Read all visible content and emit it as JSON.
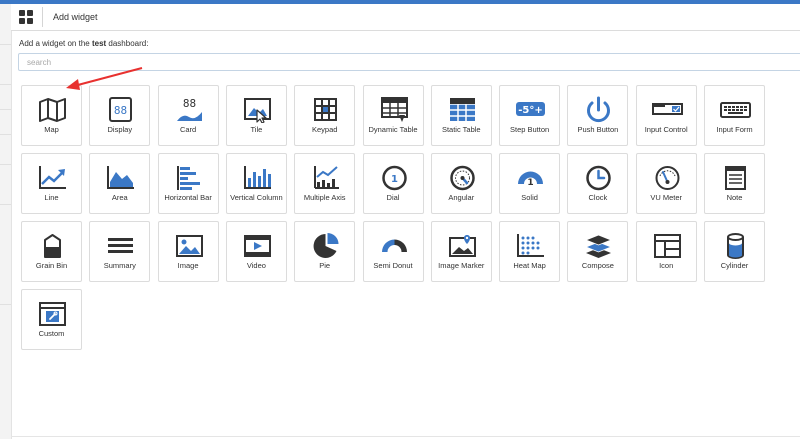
{
  "header": {
    "title": "Add widget"
  },
  "subtitle": {
    "prefix": "Add a widget on the ",
    "dashboard": "test",
    "suffix": " dashboard:"
  },
  "search": {
    "placeholder": "search"
  },
  "colors": {
    "accent": "#3b78c6",
    "icon_dark": "#333333",
    "icon_blue": "#3b78c6"
  },
  "widgets": [
    {
      "label": "Map",
      "icon": "map-icon"
    },
    {
      "label": "Display",
      "icon": "display-icon"
    },
    {
      "label": "Card",
      "icon": "card-icon"
    },
    {
      "label": "Tile",
      "icon": "tile-icon"
    },
    {
      "label": "Keypad",
      "icon": "keypad-icon"
    },
    {
      "label": "Dynamic Table",
      "icon": "dynamic-table-icon"
    },
    {
      "label": "Static Table",
      "icon": "static-table-icon"
    },
    {
      "label": "Step Button",
      "icon": "step-button-icon",
      "text": "-5°+"
    },
    {
      "label": "Push Button",
      "icon": "power-icon"
    },
    {
      "label": "Input Control",
      "icon": "input-control-icon"
    },
    {
      "label": "Input Form",
      "icon": "keyboard-icon"
    },
    {
      "label": "Line",
      "icon": "line-chart-icon"
    },
    {
      "label": "Area",
      "icon": "area-chart-icon"
    },
    {
      "label": "Horizontal Bar",
      "icon": "horizontal-bar-icon"
    },
    {
      "label": "Vertical Column",
      "icon": "vertical-column-icon"
    },
    {
      "label": "Multiple Axis",
      "icon": "multiple-axis-icon"
    },
    {
      "label": "Dial",
      "icon": "dial-icon",
      "text": "1"
    },
    {
      "label": "Angular",
      "icon": "angular-gauge-icon"
    },
    {
      "label": "Solid",
      "icon": "solid-gauge-icon",
      "text": "1"
    },
    {
      "label": "Clock",
      "icon": "clock-icon"
    },
    {
      "label": "VU Meter",
      "icon": "vu-meter-icon"
    },
    {
      "label": "Note",
      "icon": "note-icon"
    },
    {
      "label": "Grain Bin",
      "icon": "grain-bin-icon"
    },
    {
      "label": "Summary",
      "icon": "summary-icon"
    },
    {
      "label": "Image",
      "icon": "image-icon"
    },
    {
      "label": "Video",
      "icon": "video-icon"
    },
    {
      "label": "Pie",
      "icon": "pie-chart-icon"
    },
    {
      "label": "Semi Donut",
      "icon": "semi-donut-icon"
    },
    {
      "label": "Image Marker",
      "icon": "image-marker-icon"
    },
    {
      "label": "Heat Map",
      "icon": "heat-map-icon"
    },
    {
      "label": "Compose",
      "icon": "compose-icon"
    },
    {
      "label": "Icon",
      "icon": "icon-layout-icon"
    },
    {
      "label": "Cylinder",
      "icon": "cylinder-icon"
    },
    {
      "label": "Custom",
      "icon": "custom-icon"
    }
  ]
}
